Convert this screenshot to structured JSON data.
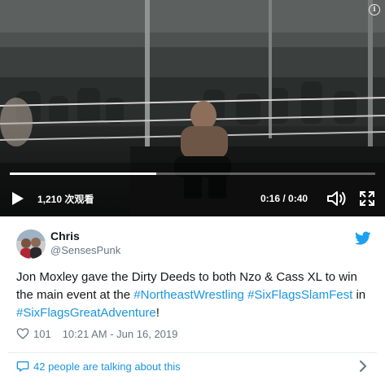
{
  "video": {
    "views_label": "1,210 次观看",
    "time_label": "0:16 / 0:40",
    "progress": 0.4
  },
  "tweet": {
    "author_name": "Chris",
    "author_handle": "@SensesPunk",
    "text_parts": {
      "p1": "Jon Moxley gave the Dirty Deeds to both Nzo & Cass XL to win the main event at the ",
      "h1": "#NortheastWrestling",
      "p2": " ",
      "h2": "#SixFlagsSlamFest",
      "p3": " in ",
      "h3": "#SixFlagsGreatAdventure",
      "p4": "!"
    },
    "like_count": "101",
    "timestamp": "10:21 AM - Jun 16, 2019",
    "talking_label": "42 people are talking about this"
  },
  "colors": {
    "link": "#1b95e0",
    "secondary_text": "#657786",
    "twitter_blue": "#1da1f2"
  },
  "icons": [
    "info-icon",
    "play-icon",
    "volume-icon",
    "fullscreen-icon",
    "twitter-bird-icon",
    "heart-icon",
    "speech-bubble-icon",
    "chevron-right-icon"
  ]
}
